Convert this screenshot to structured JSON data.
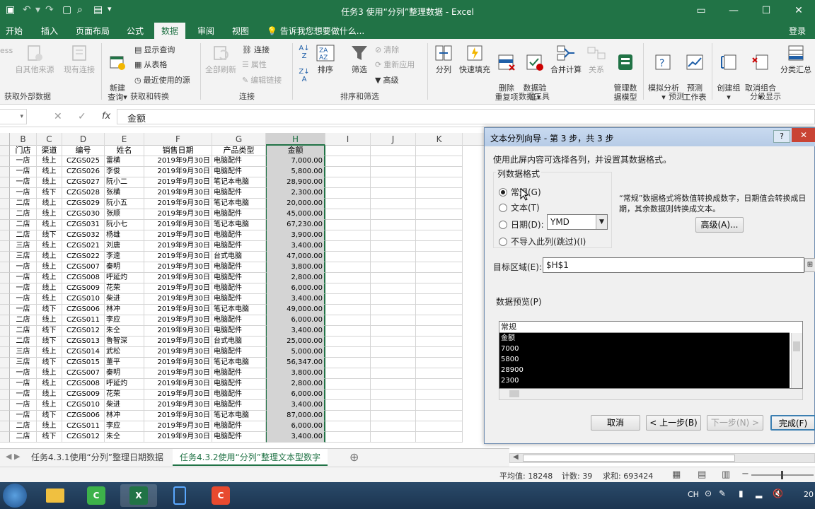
{
  "window": {
    "title": "任务3  使用“分列”整理数据 - Excel",
    "controls": [
      "?",
      "▭",
      "—",
      "☐",
      "✕"
    ],
    "quick_access": [
      "↶",
      "↷",
      "▢",
      "⌕",
      "▤",
      "▾"
    ]
  },
  "ribbon_tabs": [
    "开始",
    "插入",
    "页面布局",
    "公式",
    "数据",
    "审阅",
    "视图"
  ],
  "tell_me": "告诉我您想要做什么...",
  "login": "登录",
  "ribbon": {
    "ext_partial": "ess",
    "ext_btn1": "自其他来源",
    "ext_btn2": "现有连接",
    "ext_group": "获取外部数据",
    "new_query": "新建\n查询▾",
    "show_query": "显示查询",
    "from_table": "从表格",
    "recent_src": "最近使用的源",
    "get_group": "获取和转换",
    "refresh_all": "全部刷新",
    "connections": "连接",
    "properties": "属性",
    "edit_links": "编辑链接",
    "conn_group": "连接",
    "sort": "排序",
    "filter": "筛选",
    "clear": "清除",
    "reapply": "重新应用",
    "advanced": "高级",
    "sort_group": "排序和筛选",
    "split": "分列",
    "flash_fill": "快速填充",
    "remove_dup": "删除\n重复项",
    "validation": "数据验\n证▾",
    "consolidate": "合并计算",
    "relations": "关系",
    "manage_model": "管理数\n据模型",
    "tools_group": "数据工具",
    "whatif": "模拟分析\n▾",
    "forecast": "预测\n工作表",
    "forecast_group": "预测",
    "group": "创建组\n▾",
    "ungroup": "取消组合\n▾",
    "subtotal": "分类汇总",
    "outline_group": "分级显示"
  },
  "formula_bar": {
    "cancel": "✕",
    "enter": "✓",
    "fx": "fx",
    "content": "金额"
  },
  "columns": [
    "B",
    "C",
    "D",
    "E",
    "F",
    "G",
    "H",
    "I",
    "J",
    "K"
  ],
  "sheet": {
    "headers": [
      "门店",
      "渠道",
      "编号",
      "姓名",
      "销售日期",
      "产品类型",
      "金额"
    ],
    "rows": [
      [
        "一店",
        "线上",
        "CZGS025",
        "雷横",
        "2019年9月30日",
        "电脑配件",
        "7,000.00"
      ],
      [
        "一店",
        "线上",
        "CZGS026",
        "李俊",
        "2019年9月30日",
        "电脑配件",
        "5,800.00"
      ],
      [
        "一店",
        "线上",
        "CZGS027",
        "阮小二",
        "2019年9月30日",
        "笔记本电脑",
        "28,900.00"
      ],
      [
        "一店",
        "线下",
        "CZGS028",
        "张横",
        "2019年9月30日",
        "电脑配件",
        "2,300.00"
      ],
      [
        "二店",
        "线上",
        "CZGS029",
        "阮小五",
        "2019年9月30日",
        "笔记本电脑",
        "20,000.00"
      ],
      [
        "二店",
        "线上",
        "CZGS030",
        "张顺",
        "2019年9月30日",
        "电脑配件",
        "45,000.00"
      ],
      [
        "二店",
        "线上",
        "CZGS031",
        "阮小七",
        "2019年9月30日",
        "笔记本电脑",
        "67,230.00"
      ],
      [
        "二店",
        "线下",
        "CZGS032",
        "杨雄",
        "2019年9月30日",
        "电脑配件",
        "3,900.00"
      ],
      [
        "三店",
        "线上",
        "CZGS021",
        "刘唐",
        "2019年9月30日",
        "电脑配件",
        "3,400.00"
      ],
      [
        "三店",
        "线上",
        "CZGS022",
        "李逵",
        "2019年9月30日",
        "台式电脑",
        "47,000.00"
      ],
      [
        "一店",
        "线上",
        "CZGS007",
        "秦明",
        "2019年9月30日",
        "电脑配件",
        "3,800.00"
      ],
      [
        "一店",
        "线上",
        "CZGS008",
        "呼延灼",
        "2019年9月30日",
        "电脑配件",
        "2,800.00"
      ],
      [
        "一店",
        "线上",
        "CZGS009",
        "花荣",
        "2019年9月30日",
        "电脑配件",
        "6,000.00"
      ],
      [
        "一店",
        "线上",
        "CZGS010",
        "柴进",
        "2019年9月30日",
        "电脑配件",
        "3,400.00"
      ],
      [
        "一店",
        "线下",
        "CZGS006",
        "林冲",
        "2019年9月30日",
        "笔记本电脑",
        "49,000.00"
      ],
      [
        "二店",
        "线上",
        "CZGS011",
        "李应",
        "2019年9月30日",
        "电脑配件",
        "6,000.00"
      ],
      [
        "二店",
        "线下",
        "CZGS012",
        "朱仝",
        "2019年9月30日",
        "电脑配件",
        "3,400.00"
      ],
      [
        "二店",
        "线下",
        "CZGS013",
        "鲁智深",
        "2019年9月30日",
        "台式电脑",
        "25,000.00"
      ],
      [
        "三店",
        "线上",
        "CZGS014",
        "武松",
        "2019年9月30日",
        "电脑配件",
        "5,000.00"
      ],
      [
        "三店",
        "线下",
        "CZGS015",
        "董平",
        "2019年9月30日",
        "笔记本电脑",
        "56,347.00"
      ],
      [
        "一店",
        "线上",
        "CZGS007",
        "秦明",
        "2019年9月30日",
        "电脑配件",
        "3,800.00"
      ],
      [
        "一店",
        "线上",
        "CZGS008",
        "呼延灼",
        "2019年9月30日",
        "电脑配件",
        "2,800.00"
      ],
      [
        "一店",
        "线上",
        "CZGS009",
        "花荣",
        "2019年9月30日",
        "电脑配件",
        "6,000.00"
      ],
      [
        "一店",
        "线上",
        "CZGS010",
        "柴进",
        "2019年9月30日",
        "电脑配件",
        "3,400.00"
      ],
      [
        "一店",
        "线下",
        "CZGS006",
        "林冲",
        "2019年9月30日",
        "笔记本电脑",
        "87,000.00"
      ],
      [
        "二店",
        "线上",
        "CZGS011",
        "李应",
        "2019年9月30日",
        "电脑配件",
        "6,000.00"
      ],
      [
        "二店",
        "线下",
        "CZGS012",
        "朱仝",
        "2019年9月30日",
        "电脑配件",
        "3,400.00"
      ]
    ]
  },
  "sheet_tabs": [
    "任务4.3.1使用“分列”整理日期数据",
    "任务4.3.2使用“分列”整理文本型数字"
  ],
  "add_sheet": "⊕",
  "status": {
    "average": "平均值: 18248",
    "count": "计数: 39",
    "sum": "求和: 693424"
  },
  "dialog": {
    "title": "文本分列向导 - 第 3 步，共 3 步",
    "help": "?",
    "close": "✕",
    "instruction": "使用此屏内容可选择各列，并设置其数据格式。",
    "format_group": "列数据格式",
    "opt_general": "常规(G)",
    "opt_text": "文本(T)",
    "opt_date": "日期(D):",
    "opt_skip": "不导入此列(跳过)(I)",
    "date_value": "YMD",
    "description": "“常规”数据格式将数值转换成数字，日期值会转换成日期，其余数据则转换成文本。",
    "advanced": "高级(A)...",
    "target_label": "目标区域(E):",
    "target_value": "$H$1",
    "preview_label": "数据预览(P)",
    "preview_header": "常规",
    "preview_lines": [
      "金额",
      "7000",
      "5800",
      "28900",
      "2300"
    ],
    "cancel": "取消",
    "back": "< 上一步(B)",
    "next": "下一步(N) >",
    "finish": "完成(F)"
  },
  "tray": {
    "ime": "CH",
    "clock": "20"
  }
}
